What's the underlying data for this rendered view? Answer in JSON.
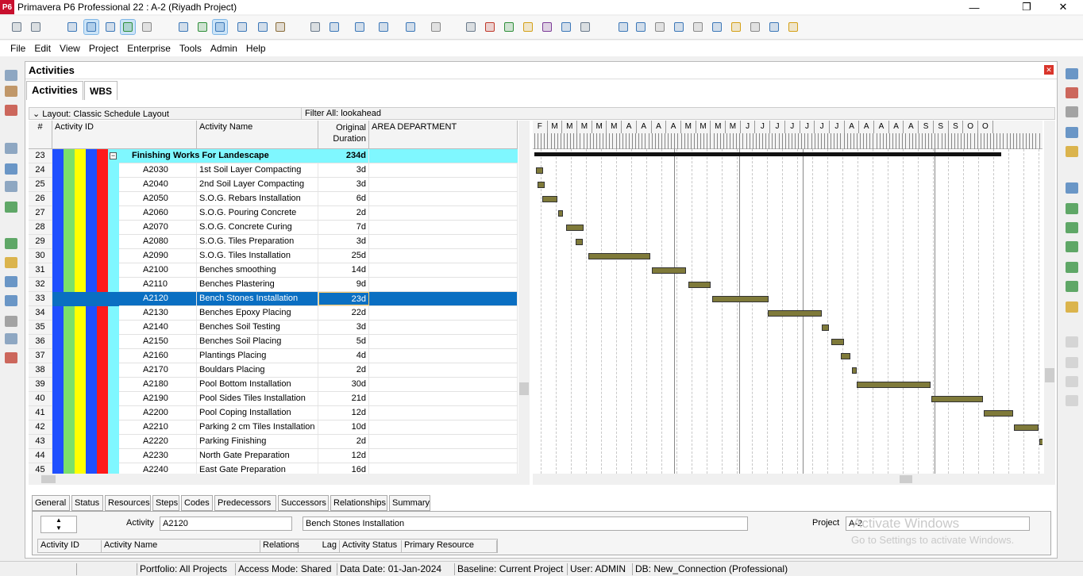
{
  "window": {
    "logo": "P6",
    "title": "Primavera P6 Professional 22 : A-2 (Riyadh Project)",
    "min": "—",
    "max": "❐",
    "close": "✕"
  },
  "menu": [
    "File",
    "Edit",
    "View",
    "Project",
    "Enterprise",
    "Tools",
    "Admin",
    "Help"
  ],
  "panel": {
    "title": "Activities",
    "tabs": [
      "Activities",
      "WBS"
    ],
    "layout": "Layout: Classic Schedule Layout",
    "filter": "Filter All: lookahead"
  },
  "columns": {
    "num": "#",
    "id": "Activity ID",
    "name": "Activity Name",
    "dur1": "Original",
    "dur2": "Duration",
    "dept": "AREA DEPARTMENT"
  },
  "group": {
    "num": "23",
    "name": "Finishing Works For Landescape",
    "dur": "234d"
  },
  "rows": [
    {
      "num": "24",
      "id": "A2030",
      "name": "1st Soil Layer Compacting",
      "dur": "3d"
    },
    {
      "num": "25",
      "id": "A2040",
      "name": "2nd Soil Layer Compacting",
      "dur": "3d"
    },
    {
      "num": "26",
      "id": "A2050",
      "name": "S.O.G. Rebars Installation",
      "dur": "6d"
    },
    {
      "num": "27",
      "id": "A2060",
      "name": "S.O.G. Pouring Concrete",
      "dur": "2d"
    },
    {
      "num": "28",
      "id": "A2070",
      "name": "S.O.G. Concrete Curing",
      "dur": "7d"
    },
    {
      "num": "29",
      "id": "A2080",
      "name": "S.O.G. Tiles Preparation",
      "dur": "3d"
    },
    {
      "num": "30",
      "id": "A2090",
      "name": "S.O.G. Tiles Installation",
      "dur": "25d"
    },
    {
      "num": "31",
      "id": "A2100",
      "name": "Benches smoothing",
      "dur": "14d"
    },
    {
      "num": "32",
      "id": "A2110",
      "name": "Benches Plastering",
      "dur": "9d"
    },
    {
      "num": "33",
      "id": "A2120",
      "name": "Bench Stones Installation",
      "dur": "23d"
    },
    {
      "num": "34",
      "id": "A2130",
      "name": "Benches Epoxy Placing",
      "dur": "22d"
    },
    {
      "num": "35",
      "id": "A2140",
      "name": "Benches Soil Testing",
      "dur": "3d"
    },
    {
      "num": "36",
      "id": "A2150",
      "name": "Benches Soil Placing",
      "dur": "5d"
    },
    {
      "num": "37",
      "id": "A2160",
      "name": "Plantings Placing",
      "dur": "4d"
    },
    {
      "num": "38",
      "id": "A2170",
      "name": "Bouldars Placing",
      "dur": "2d"
    },
    {
      "num": "39",
      "id": "A2180",
      "name": "Pool Bottom Installation",
      "dur": "30d"
    },
    {
      "num": "40",
      "id": "A2190",
      "name": "Pool Sides Tiles Installation",
      "dur": "21d"
    },
    {
      "num": "41",
      "id": "A2200",
      "name": "Pool Coping Installation",
      "dur": "12d"
    },
    {
      "num": "42",
      "id": "A2210",
      "name": "Parking 2 cm Tiles Installation",
      "dur": "10d"
    },
    {
      "num": "43",
      "id": "A2220",
      "name": "Parking Finishing",
      "dur": "2d"
    },
    {
      "num": "44",
      "id": "A2230",
      "name": "North Gate Preparation",
      "dur": "12d"
    },
    {
      "num": "45",
      "id": "A2240",
      "name": "East Gate Preparation",
      "dur": "16d"
    }
  ],
  "selected_row": 9,
  "band_colors": [
    "#1f4fff",
    "#7be06a",
    "#ffff00",
    "#1f4fff",
    "#ff1a1a"
  ],
  "group_color": "#7ff7ff",
  "select_color": "#0a6fc2",
  "bar_color": "#7f7a3a",
  "months": [
    "F",
    "M",
    "M",
    "M",
    "M",
    "M",
    "A",
    "A",
    "A",
    "A",
    "M",
    "M",
    "M",
    "M",
    "J",
    "J",
    "J",
    "J",
    "J",
    "J",
    "J",
    "A",
    "A",
    "A",
    "A",
    "A",
    "S",
    "S",
    "S",
    "O",
    "O"
  ],
  "bottom_tabs": [
    "General",
    "Status",
    "Resources",
    "Steps",
    "Codes",
    "Predecessors",
    "Successors",
    "Relationships",
    "Summary"
  ],
  "detail": {
    "activity_label": "Activity",
    "activity_id": "A2120",
    "activity_name": "Bench Stones Installation",
    "project_label": "Project",
    "project": "A-2",
    "cols": [
      "Activity ID",
      "Activity Name",
      "Relations",
      "Lag",
      "Activity Status",
      "Primary Resource"
    ]
  },
  "status": [
    "Portfolio: All Projects",
    "Access Mode: Shared",
    "Data Date: 01-Jan-2024",
    "Baseline: Current Project",
    "User: ADMIN",
    "DB: New_Connection (Professional)"
  ],
  "watermark": {
    "a": "Activate Windows",
    "b": "Go to Settings to activate Windows."
  }
}
